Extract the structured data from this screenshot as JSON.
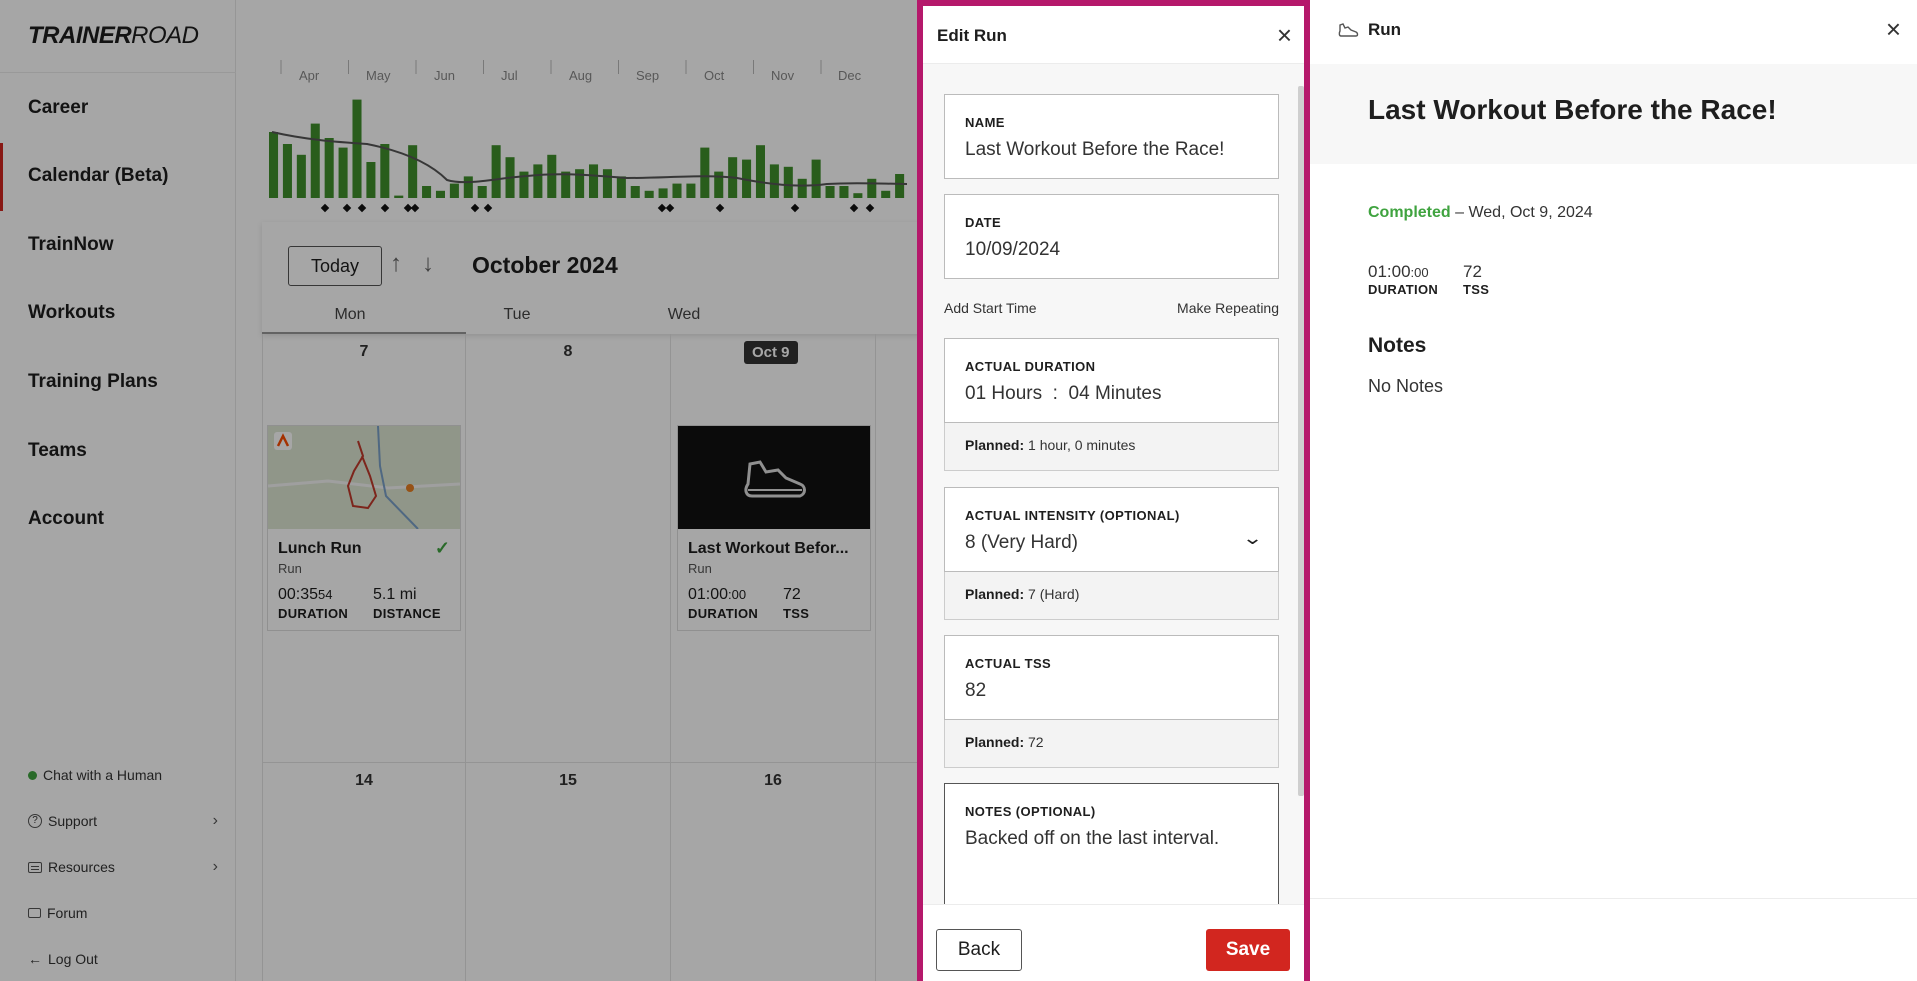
{
  "brand": {
    "logo_bold": "TRAINER",
    "logo_light": "ROAD"
  },
  "sidebar": {
    "nav": [
      "Career",
      "Calendar (Beta)",
      "TrainNow",
      "Workouts",
      "Training Plans",
      "Teams",
      "Account"
    ],
    "footer": {
      "chat": "Chat with a Human",
      "support": "Support",
      "resources": "Resources",
      "forum": "Forum",
      "logout": "Log Out"
    }
  },
  "calendar": {
    "months": [
      "Apr",
      "May",
      "Jun",
      "Jul",
      "Aug",
      "Sep",
      "Oct",
      "Nov",
      "Dec"
    ],
    "today_label": "Today",
    "month_title": "October 2024",
    "weekdays": [
      "Mon",
      "Tue",
      "Wed"
    ],
    "week1": [
      "7",
      "8"
    ],
    "today_chip": "Oct 9",
    "week2": [
      "14",
      "15",
      "16"
    ],
    "cards": [
      {
        "title": "Lunch Run",
        "type": "Run",
        "v1_main": "00:35",
        "v1_small": "54",
        "v1_label": "DURATION",
        "v2": "5.1 mi",
        "v2_label": "DISTANCE"
      },
      {
        "title": "Last Workout Befor...",
        "type": "Run",
        "v1_main": "01:00",
        "v1_small": ":00",
        "v1_label": "DURATION",
        "v2": "72",
        "v2_label": "TSS"
      }
    ],
    "load_chart_bars": [
      0.55,
      0.45,
      0.36,
      0.62,
      0.5,
      0.42,
      0.82,
      0.3,
      0.45,
      0.02,
      0.44,
      0.1,
      0.06,
      0.12,
      0.18,
      0.1,
      0.44,
      0.34,
      0.22,
      0.28,
      0.36,
      0.22,
      0.24,
      0.28,
      0.24,
      0.18,
      0.1,
      0.06,
      0.08,
      0.12,
      0.12,
      0.42,
      0.22,
      0.34,
      0.32,
      0.44,
      0.28,
      0.26,
      0.16,
      0.32,
      0.1,
      0.1,
      0.04,
      0.16,
      0.06,
      0.2
    ]
  },
  "edit_panel": {
    "title": "Edit Run",
    "name_label": "NAME",
    "name_value": "Last Workout Before the Race!",
    "date_label": "DATE",
    "date_value": "10/09/2024",
    "add_start_time": "Add Start Time",
    "make_repeating": "Make Repeating",
    "duration_label": "ACTUAL DURATION",
    "duration_hours": "01",
    "hours_unit": "Hours",
    "duration_sep": ":",
    "duration_minutes": "04",
    "minutes_unit": "Minutes",
    "planned_label": "Planned:",
    "duration_planned": "1 hour, 0 minutes",
    "intensity_label": "ACTUAL INTENSITY (OPTIONAL)",
    "intensity_value": "8 (Very Hard)",
    "intensity_planned": "7 (Hard)",
    "tss_label": "ACTUAL TSS",
    "tss_value": "82",
    "tss_planned": "72",
    "notes_label": "NOTES (OPTIONAL)",
    "notes_value": "Backed off on the last interval.",
    "back_label": "Back",
    "save_label": "Save"
  },
  "detail_panel": {
    "type": "Run",
    "title": "Last Workout Before the Race!",
    "status": "Completed",
    "date_text": "– Wed, Oct 9, 2024",
    "duration_main": "01:00",
    "duration_small": ":00",
    "duration_label": "DURATION",
    "tss_value": "72",
    "tss_label": "TSS",
    "notes_heading": "Notes",
    "notes_text": "No Notes"
  },
  "colors": {
    "accent": "#d2261f",
    "highlight_border": "#b5186b",
    "completed": "#3fa33f",
    "bar": "#3f8f2c"
  }
}
